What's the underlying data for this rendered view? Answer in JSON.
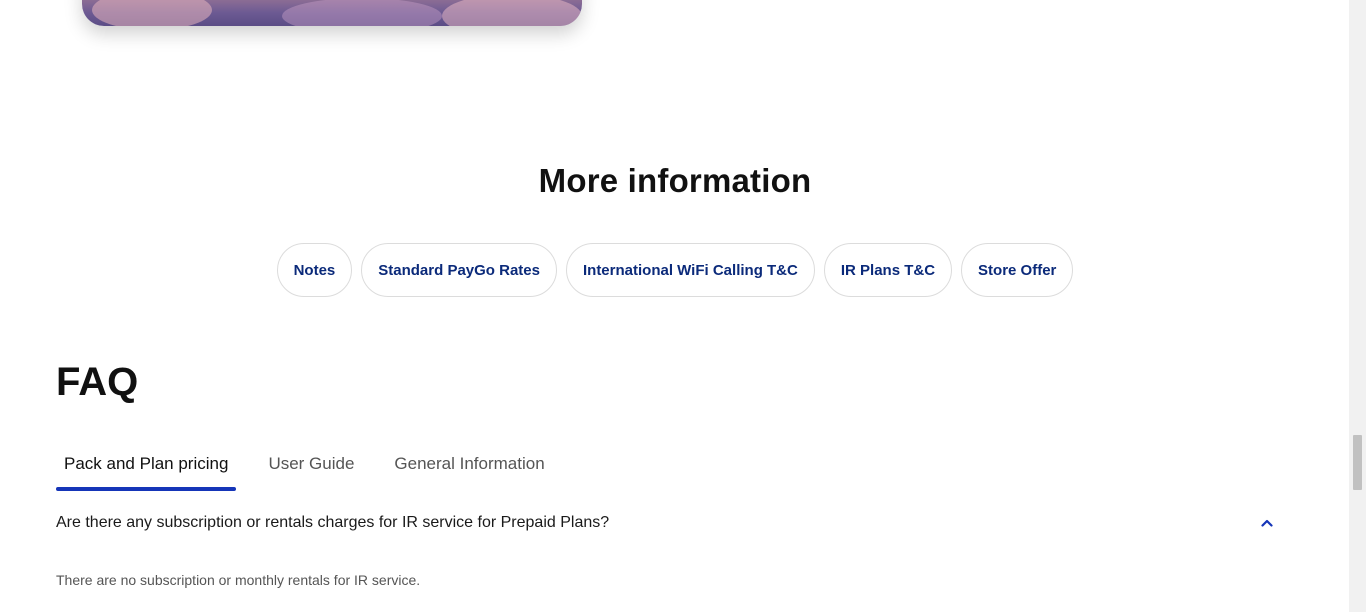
{
  "more_info": {
    "title": "More information",
    "chips": [
      {
        "label": "Notes"
      },
      {
        "label": "Standard PayGo Rates"
      },
      {
        "label": "International WiFi Calling T&C"
      },
      {
        "label": "IR Plans T&C"
      },
      {
        "label": "Store Offer"
      }
    ]
  },
  "faq": {
    "title": "FAQ",
    "tabs": [
      {
        "label": "Pack and Plan pricing",
        "active": true
      },
      {
        "label": "User Guide",
        "active": false
      },
      {
        "label": "General Information",
        "active": false
      }
    ],
    "items": [
      {
        "question": "Are there any subscription or rentals charges for IR service for Prepaid Plans?",
        "answer": "There are no subscription or monthly rentals for IR service.",
        "expanded": true
      }
    ]
  },
  "icons": {
    "expand": "chevron-up-icon"
  },
  "colors": {
    "accent": "#1535b8",
    "chip_text": "#0b2a7a",
    "heading": "#111111"
  }
}
